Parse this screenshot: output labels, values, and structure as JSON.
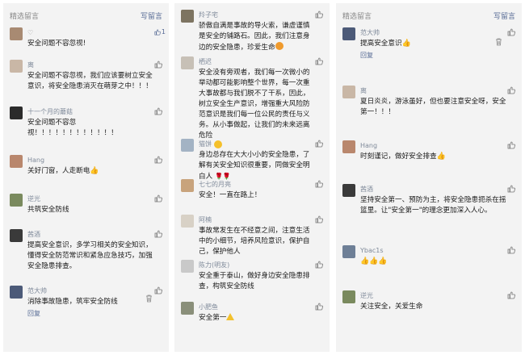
{
  "panel1": {
    "header_title": "精选留言",
    "write_label": "写留言",
    "comments": [
      {
        "name": "",
        "text": "安全问题不容忽视!",
        "likes": "1",
        "avatar_color": "#a88a72"
      },
      {
        "name": "离",
        "text": "安全问题不容忽视，我们应该要树立安全意识，将安全隐患消灭在萌芽之中！！！",
        "avatar_color": "#c9b7a6"
      },
      {
        "name": "十一个月的蘑菇",
        "text": "安全问题不容忽视！！！！！！！！！！！！",
        "avatar_color": "#2b2b2b"
      },
      {
        "name": "Hang",
        "text": "关好门窗，人走断电",
        "avatar_color": "#b9876d"
      },
      {
        "name": "逆光",
        "text": "共筑安全防线",
        "avatar_color": "#7a8a5e"
      },
      {
        "name": "茜酒",
        "text": "提高安全意识，多学习相关的安全知识，懂得安全防范常识和紧急应急技巧，加强安全隐患排查。",
        "avatar_color": "#3a3a3a"
      },
      {
        "name": "范大帅",
        "text": "消除事故隐患，筑牢安全防线",
        "reply": "回复",
        "avatar_color": "#4c5a78"
      }
    ]
  },
  "panel2": {
    "comments": [
      {
        "name": "羚子宅",
        "text": "骄傲自满是事故的导火索，谦虚谨慎是安全的铺路石。因此，我们注意身边的安全隐患，珍爱生命",
        "avatar_color": "#7d7461"
      },
      {
        "name": "栖迟",
        "text": "安全没有旁观者，我们每一次微小的举动都可能影响整个世界，每一次重大事故都与我们脱不了干系，因此，树立安全生产意识，增强重大风险防范意识是我们每一位公民的责任与义务。从小事做起，让我们的未来远离危险",
        "avatar_color": "#c7c0b6"
      },
      {
        "name": "猫饼",
        "text": "身边总存在大大小小的安全隐患，了解有关安全知识很重要，同做安全明白人",
        "avatar_color": "#a3b3c4"
      },
      {
        "name": "七七的月亮",
        "text": "安全！一直在路上！",
        "avatar_color": "#c8a37c"
      },
      {
        "name": "阿楠",
        "text": "事故常发生在不经意之间，注意生活中的小细节，培养风险意识，保护自己，保护他人",
        "avatar_color": "#d8d1c6"
      },
      {
        "name": "陈力(明友)",
        "text": "安全重于泰山，做好身边安全隐患排查，构筑安全防线",
        "avatar_color": "#c9c9c9"
      },
      {
        "name": "小肥鱼",
        "text": "安全第一",
        "avatar_color": "#8a8f7a"
      }
    ]
  },
  "panel3": {
    "header_title": "精选留言",
    "write_label": "写留言",
    "comments": [
      {
        "name": "范大帅",
        "text": "提高安全意识",
        "reply": "回复",
        "avatar_color": "#4c5a78"
      },
      {
        "name": "离",
        "text": "夏日炎炎，游泳虽好，但也要注意安全呀，安全第一！！！",
        "avatar_color": "#c9b7a6"
      },
      {
        "name": "Hang",
        "text": "时刻谨记，做好安全排查",
        "avatar_color": "#b9876d"
      },
      {
        "name": "茜酒",
        "text": "坚持安全第一、预防为主，将安全隐患扼杀在摇篮里。让\"安全第一\"的理念更加深入人心。",
        "avatar_color": "#3a3a3a"
      },
      {
        "name": "Ybac1s",
        "text": "",
        "avatar_color": "#6e7f96"
      },
      {
        "name": "逆光",
        "text": "关注安全，关爱生命",
        "avatar_color": "#7a8a5e"
      }
    ]
  }
}
